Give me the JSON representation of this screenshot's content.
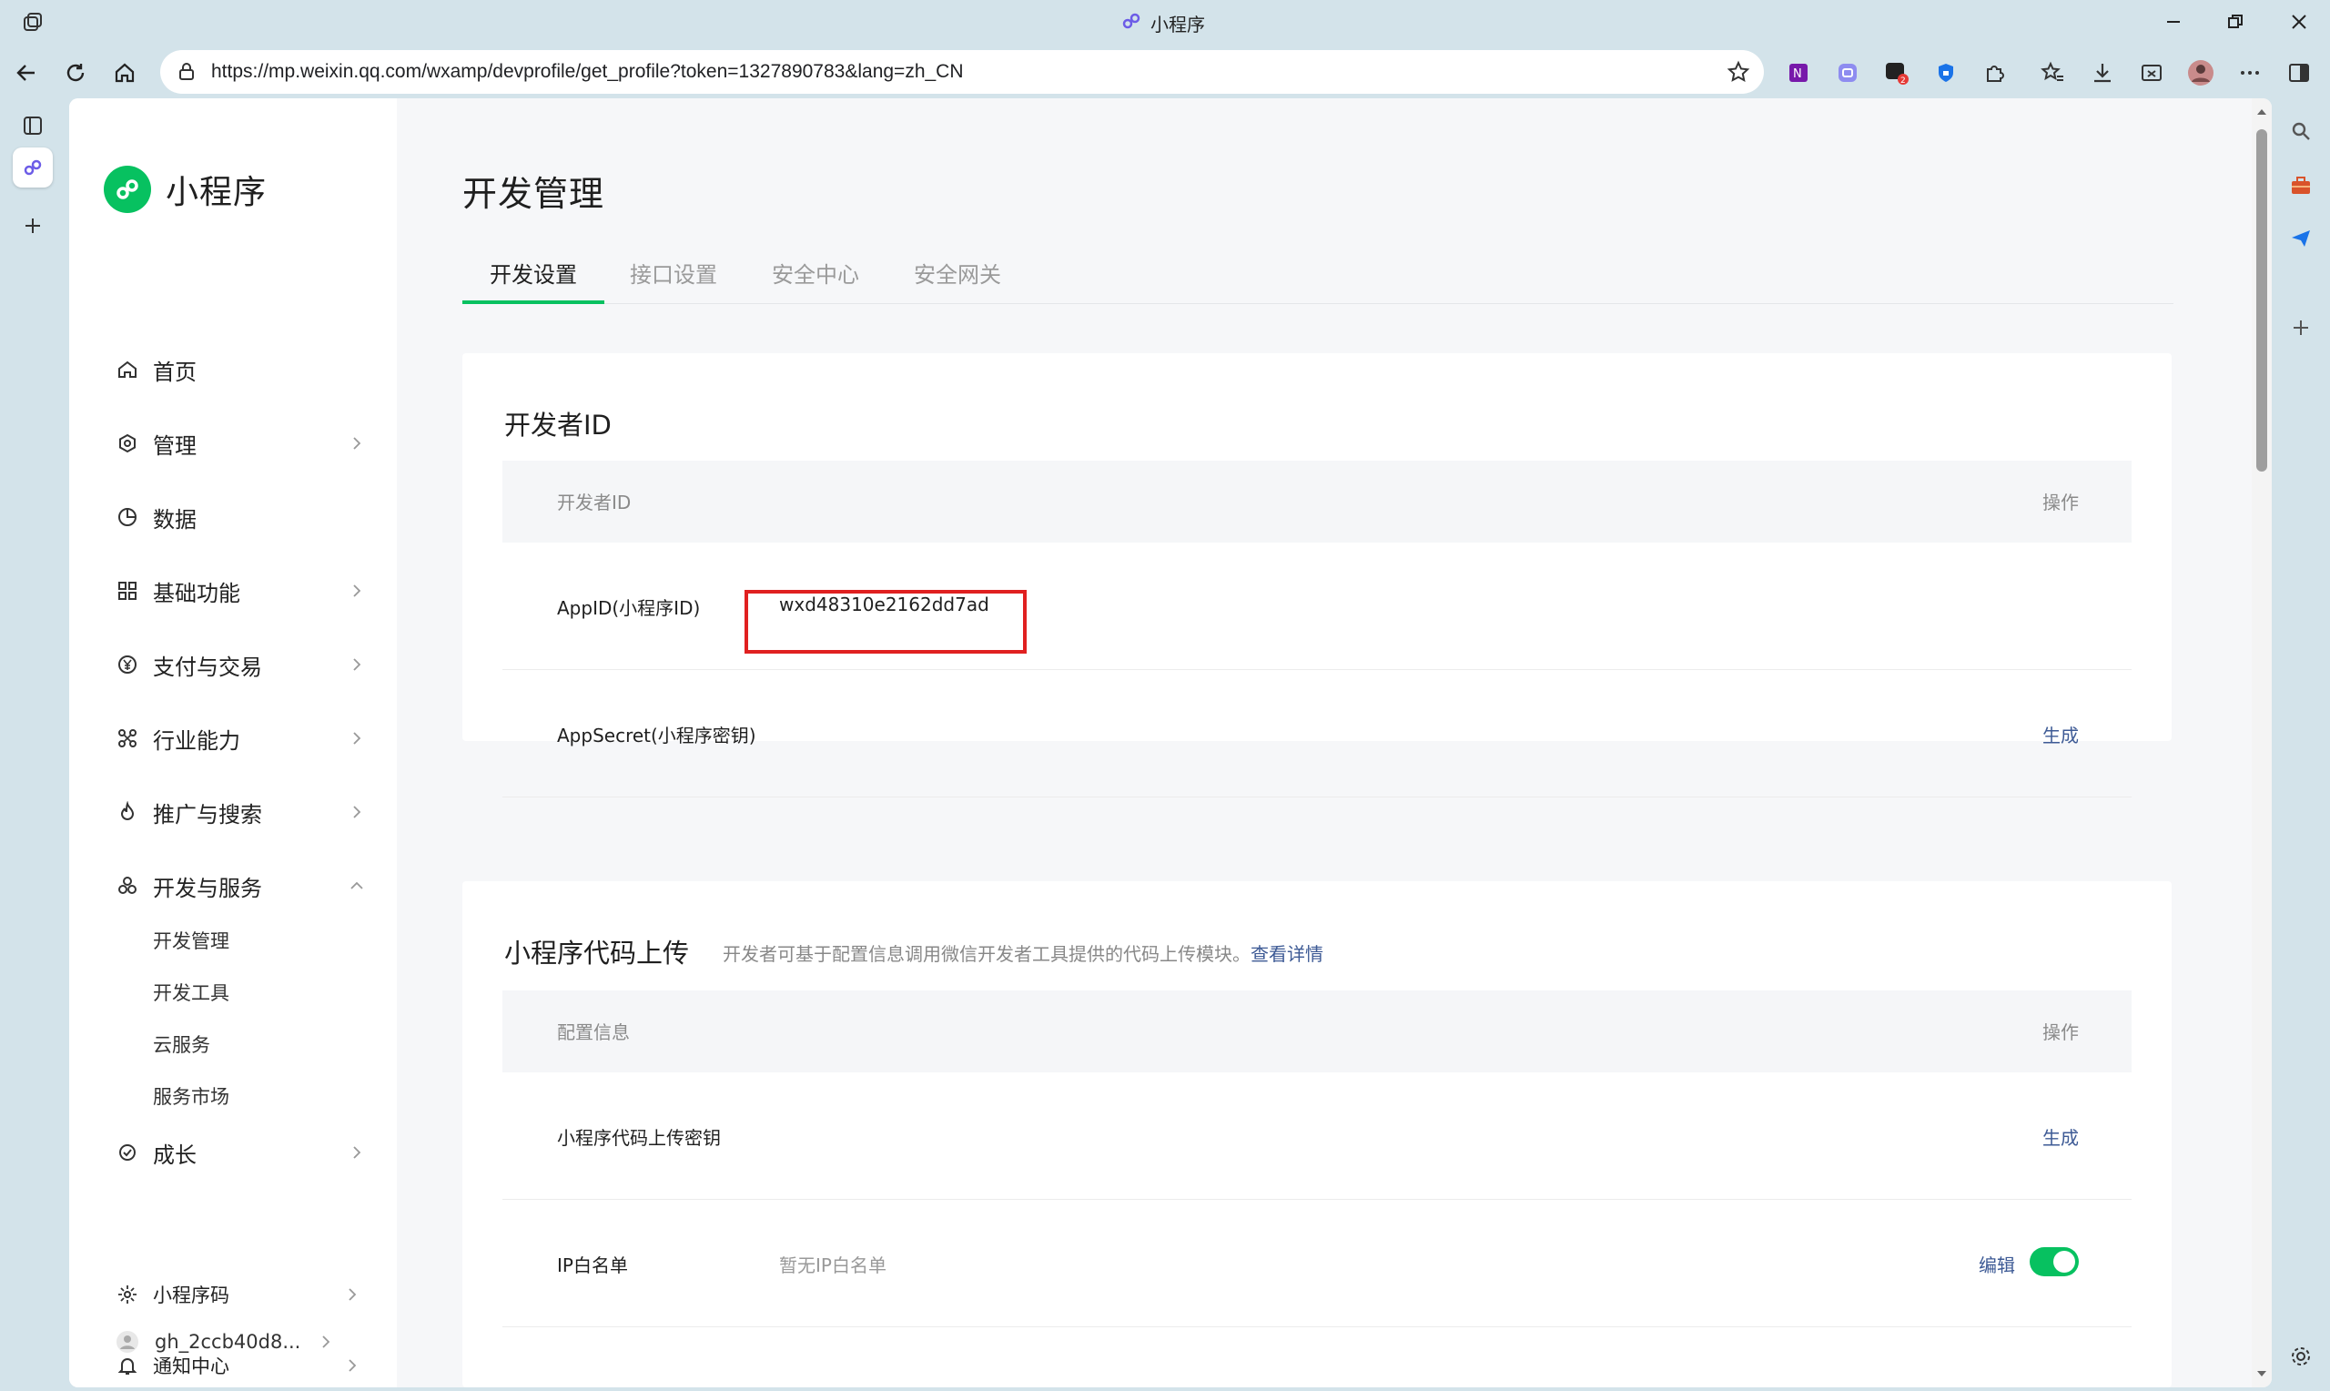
{
  "browser": {
    "window_title": "小程序",
    "url": "https://mp.weixin.qq.com/wxamp/devprofile/get_profile?token=1327890783&lang=zh_CN",
    "notification_badge": "2"
  },
  "sidebar": {
    "logo_text": "小程序",
    "items": [
      {
        "label": "首页",
        "icon": "home-icon"
      },
      {
        "label": "管理",
        "icon": "settings-hexagon-icon"
      },
      {
        "label": "数据",
        "icon": "pie-chart-icon"
      },
      {
        "label": "基础功能",
        "icon": "grid-icon"
      },
      {
        "label": "支付与交易",
        "icon": "yuan-icon"
      },
      {
        "label": "行业能力",
        "icon": "nodes-icon"
      },
      {
        "label": "推广与搜索",
        "icon": "flame-icon"
      },
      {
        "label": "开发与服务",
        "icon": "cluster-icon"
      },
      {
        "label": "成长",
        "icon": "medal-icon"
      }
    ],
    "sub_items": [
      "开发管理",
      "开发工具",
      "云服务",
      "服务市场"
    ],
    "bottom": {
      "qrcode_label": "小程序码",
      "notify_label": "通知中心",
      "account_label": "gh_2ccb40d8..."
    }
  },
  "main": {
    "title": "开发管理",
    "tabs": [
      "开发设置",
      "接口设置",
      "安全中心",
      "安全网关"
    ],
    "active_tab": 0,
    "developer_card": {
      "title": "开发者ID",
      "header_col1": "开发者ID",
      "header_col2": "操作",
      "appid_label": "AppID(小程序ID)",
      "appid_value": "wxd48310e2162dd7ad",
      "appsecret_label": "AppSecret(小程序密钥)",
      "appsecret_action": "生成"
    },
    "upload_card": {
      "title": "小程序代码上传",
      "desc": "开发者可基于配置信息调用微信开发者工具提供的代码上传模块。",
      "desc_link": "查看详情",
      "header_col1": "配置信息",
      "header_col2": "操作",
      "key_label": "小程序代码上传密钥",
      "key_action": "生成",
      "ip_label": "IP白名单",
      "ip_value": "暂无IP白名单",
      "ip_action": "编辑",
      "ip_toggle_on": true
    }
  },
  "colors": {
    "accent": "#07c160",
    "link": "#3d5a95",
    "highlight": "#e02020"
  }
}
